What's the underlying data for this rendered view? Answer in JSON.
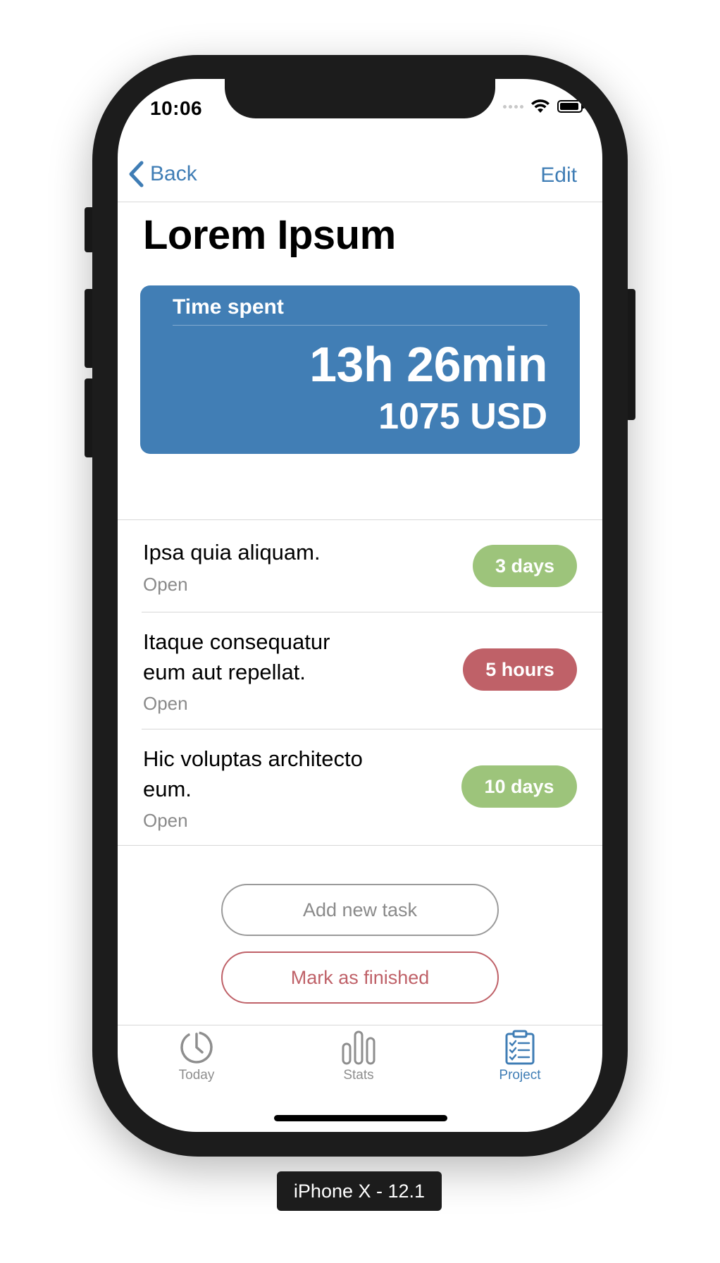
{
  "status_bar": {
    "time": "10:06"
  },
  "nav": {
    "back_label": "Back",
    "edit_label": "Edit"
  },
  "project": {
    "title": "Lorem Ipsum"
  },
  "summary": {
    "label": "Time spent",
    "time": "13h 26min",
    "money": "1075 USD"
  },
  "tasks": [
    {
      "title_lines": [
        "Ipsa quia aliquam."
      ],
      "status": "Open",
      "badge": "3 days",
      "badge_color": "#9dc47b"
    },
    {
      "title_lines": [
        "Itaque consequatur",
        "eum aut repellat."
      ],
      "status": "Open",
      "badge": "5 hours",
      "badge_color": "#bf6168"
    },
    {
      "title_lines": [
        "Hic voluptas architecto",
        "eum."
      ],
      "status": "Open",
      "badge": "10 days",
      "badge_color": "#9dc47b"
    }
  ],
  "actions": {
    "add_task": "Add new task",
    "mark_finished": "Mark as finished"
  },
  "tabbar": {
    "items": [
      {
        "label": "Today",
        "icon": "timer-icon",
        "active": false
      },
      {
        "label": "Stats",
        "icon": "bar-chart-icon",
        "active": false
      },
      {
        "label": "Project",
        "icon": "clipboard-checklist-icon",
        "active": true
      }
    ],
    "active_color": "#3f7db5",
    "inactive_color": "#8e8e8e"
  },
  "device_label": "iPhone X - 12.1",
  "colors": {
    "accent": "#3f7db5",
    "card": "#417eb5",
    "green": "#9dc47b",
    "red": "#bf6168"
  }
}
